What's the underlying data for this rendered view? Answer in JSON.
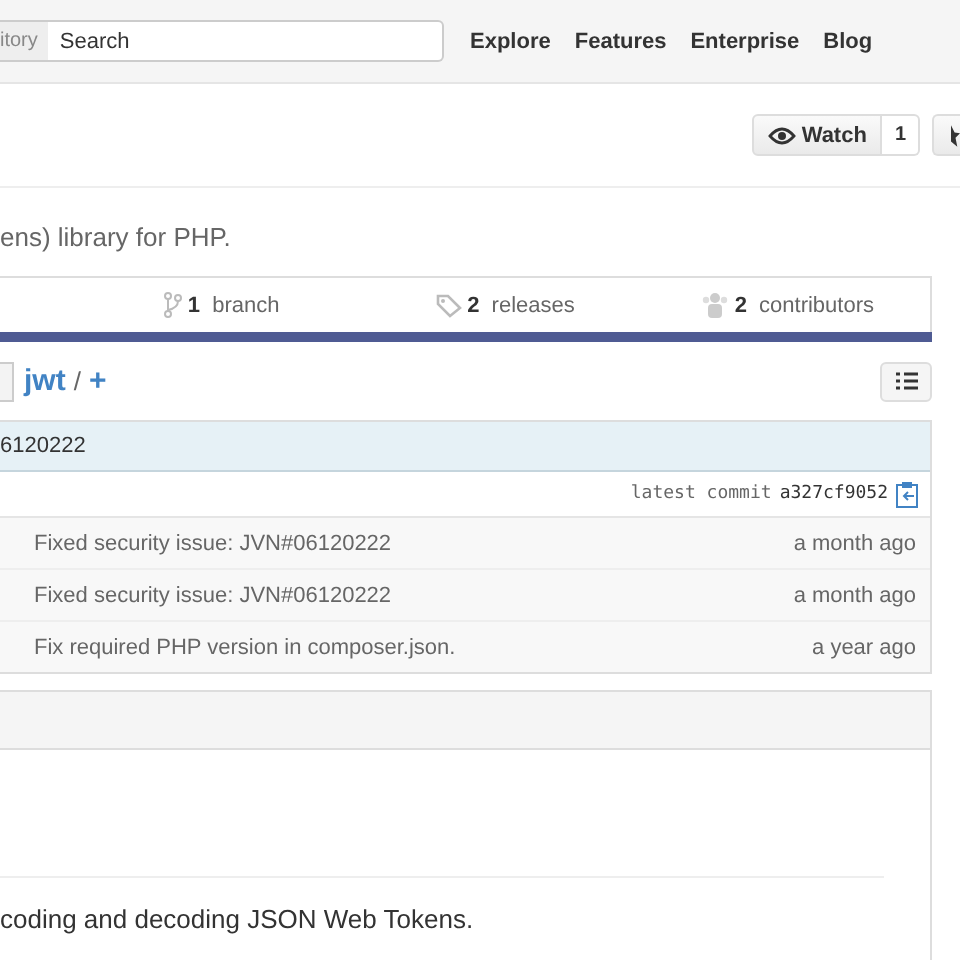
{
  "header": {
    "search_scope": "itory",
    "search_placeholder": "Search",
    "nav": [
      "Explore",
      "Features",
      "Enterprise",
      "Blog"
    ]
  },
  "actions": {
    "watch_label": "Watch",
    "watch_count": "1"
  },
  "description": "ens) library for PHP.",
  "stats": [
    {
      "kind": "branch",
      "count": "1",
      "label": "branch"
    },
    {
      "kind": "tag",
      "count": "2",
      "label": "releases"
    },
    {
      "kind": "people",
      "count": "2",
      "label": "contributors"
    }
  ],
  "path": {
    "repo": "jwt",
    "separator": "/",
    "add": "+"
  },
  "commit": {
    "message": "6120222",
    "label": "latest commit",
    "sha": "a327cf9052"
  },
  "files": [
    {
      "message": "Fixed security issue: JVN#06120222",
      "age": "a month ago"
    },
    {
      "message": "Fixed security issue: JVN#06120222",
      "age": "a month ago"
    },
    {
      "message": "Fix required PHP version in composer.json.",
      "age": "a year ago"
    }
  ],
  "readme": {
    "text": "coding and decoding JSON Web Tokens."
  }
}
